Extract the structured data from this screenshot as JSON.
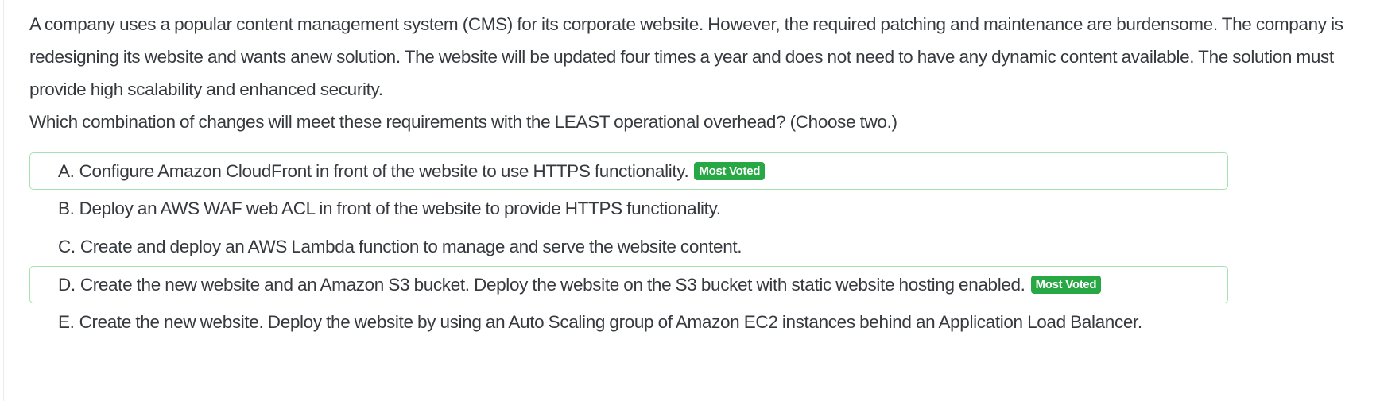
{
  "question": {
    "paragraph1": "A company uses a popular content management system (CMS) for its corporate website. However, the required patching and maintenance are burdensome. The company is redesigning its website and wants anew solution. The website will be updated four times a year and does not need to have any dynamic content available. The solution must provide high scalability and enhanced security.",
    "paragraph2": "Which combination of changes will meet these requirements with the LEAST operational overhead? (Choose two.)"
  },
  "choices": [
    {
      "letter": "A.",
      "text": "Configure Amazon CloudFront in front of the website to use HTTPS functionality.",
      "badge": "Most Voted"
    },
    {
      "letter": "B.",
      "text": "Deploy an AWS WAF web ACL in front of the website to provide HTTPS functionality.",
      "badge": ""
    },
    {
      "letter": "C.",
      "text": "Create and deploy an AWS Lambda function to manage and serve the website content.",
      "badge": ""
    },
    {
      "letter": "D.",
      "text": "Create the new website and an Amazon S3 bucket. Deploy the website on the S3 bucket with static website hosting enabled.",
      "badge": "Most Voted"
    },
    {
      "letter": "E.",
      "text": "Create the new website. Deploy the website by using an Auto Scaling group of Amazon EC2 instances behind an Application Load Balancer.",
      "badge": ""
    }
  ],
  "colors": {
    "badge": "#28a745",
    "voted_border": "#a6e2b0",
    "text": "#363a3f"
  }
}
